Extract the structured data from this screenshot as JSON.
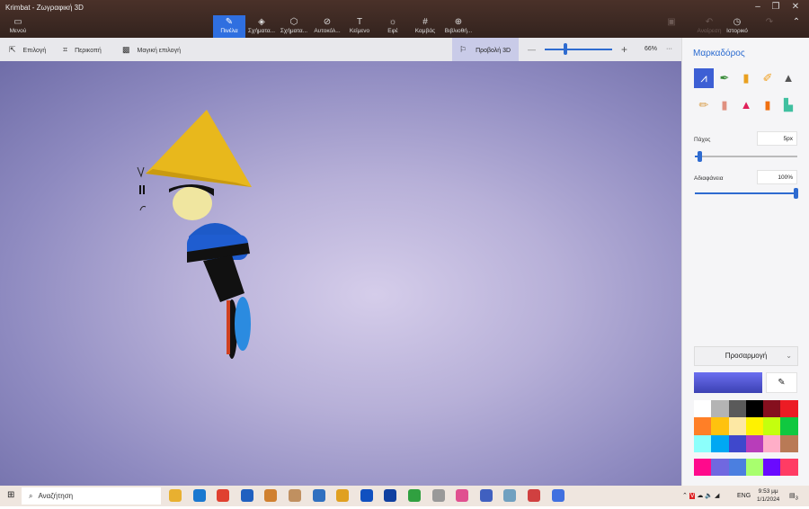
{
  "window": {
    "title": "Krimbat - Ζωγραφική 3D",
    "minimize": "–",
    "restore": "❐",
    "close": "✕"
  },
  "menu": {
    "label": "Μενού",
    "icon": "folder-icon"
  },
  "tools": [
    {
      "label": "Πινέλα",
      "icon": "brush-icon",
      "active": true
    },
    {
      "label": "Σχήματα...",
      "icon": "2d-shapes-icon"
    },
    {
      "label": "Σχήματα...",
      "icon": "3d-shapes-icon"
    },
    {
      "label": "Αυτοκόλ...",
      "icon": "sticker-icon"
    },
    {
      "label": "Κείμενο",
      "icon": "text-icon"
    },
    {
      "label": "Εφέ",
      "icon": "effects-icon"
    },
    {
      "label": "Καμβάς",
      "icon": "canvas-icon"
    },
    {
      "label": "Βιβλιοθή...",
      "icon": "library-icon"
    }
  ],
  "history": {
    "paste_icon": "paste-icon",
    "undo": "Αναίρεση",
    "history": "Ιστορικό"
  },
  "subbar": {
    "select": "Επιλογή",
    "crop": "Περικοπή",
    "magic": "Μαγική επιλογή",
    "view3d": "Προβολή 3D",
    "zoom_out": "—",
    "zoom_in": "+",
    "zoom": "66%",
    "zoom_value": 66,
    "more": "···"
  },
  "panel": {
    "title": "Μαρκαδόρος",
    "thickness_label": "Πάχος",
    "thickness": "5px",
    "thickness_fraction": 0.03,
    "opacity_label": "Αδιαφάνεια",
    "opacity": "100%",
    "opacity_fraction": 1.0,
    "color_mode": "Προσαρμογή",
    "current_color": "#5558d8",
    "brushes": [
      "marker",
      "calligraphy-pen",
      "oil-brush",
      "watercolor",
      "pixel-pen",
      "pencil",
      "eraser",
      "crayon",
      "spray-can",
      "fill-bucket"
    ],
    "palette": [
      "#ffffff",
      "#b4b4b4",
      "#5a5a5a",
      "#000000",
      "#850f1e",
      "#ec1c24",
      "#ff7f27",
      "#ffc20e",
      "#fde8a4",
      "#fff200",
      "#c4ff0e",
      "#10c840",
      "#8cfffb",
      "#00a8f3",
      "#3f48cc",
      "#b83dba",
      "#ffaec8",
      "#b97a56"
    ],
    "custom_palette": [
      "#ff0a8c",
      "#7068e0",
      "#4b7fe0",
      "#a8ff6e",
      "#6a0aff",
      "#ff3c64"
    ]
  },
  "taskbar": {
    "search_placeholder": "Αναζήτηση",
    "lang": "ENG",
    "time": "9:53 μμ",
    "date": "1/1/2024",
    "notif": "3"
  }
}
